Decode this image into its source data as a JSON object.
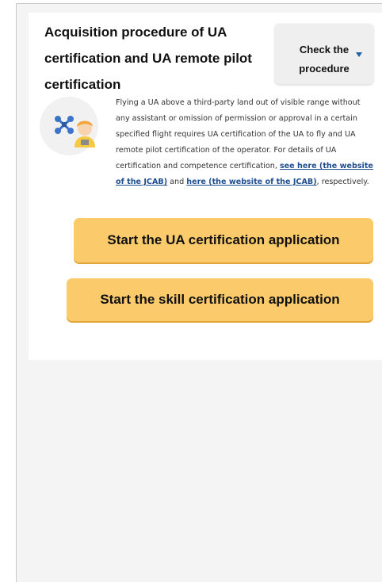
{
  "section": {
    "title": "Acquisition procedure of UA certification and UA remote pilot certification"
  },
  "check_button": {
    "label": "Check the procedure"
  },
  "description": {
    "text_1": "Flying a UA above a third-party land out of visible range without any assistant or omission of permission or approval in a certain specified flight requires UA certification of the UA to fly and UA remote pilot certification of the operator. For details of UA certification and competence certification, ",
    "link_1": "see here (the website of the JCAB)",
    "text_2": " and ",
    "link_2": "here (the website of the JCAB)",
    "text_3": ", respectively."
  },
  "actions": {
    "ua_cert_label": "Start the UA certification application",
    "skill_cert_label": "Start the skill certification application"
  },
  "icons": {
    "avatar": "drone-operator-icon",
    "dropdown": "caret-down-icon"
  },
  "colors": {
    "primary_button": "#fbcb6b",
    "link": "#1e4d8f",
    "caret": "#1d5fa8",
    "drone": "#3b74c9",
    "operator_hair": "#f2a33a"
  }
}
